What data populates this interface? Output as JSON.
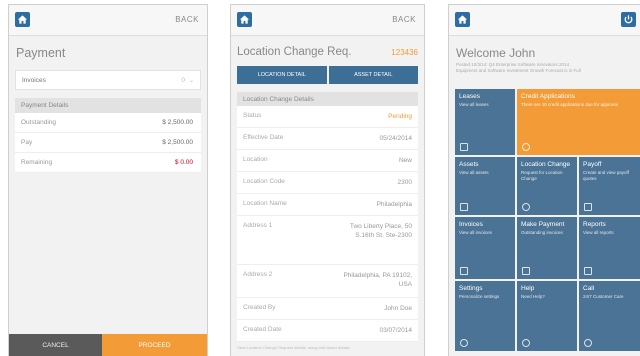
{
  "phone1": {
    "title": "Payment",
    "select": {
      "label": "Invoices",
      "count": "0"
    },
    "section": "Payment Details",
    "rows": [
      {
        "label": "Outstanding",
        "value": "$ 2,500.00"
      },
      {
        "label": "Pay",
        "value": "$ 2,500.00"
      },
      {
        "label": "Remaining",
        "value": "$ 0.00"
      }
    ],
    "back": "BACK",
    "cancel": "CANCEL",
    "proceed": "PROCEED"
  },
  "phone2": {
    "title": "Location Change Req.",
    "number": "123436",
    "back": "BACK",
    "tabs": [
      "LOCATION DETAIL",
      "ASSET DETAIL"
    ],
    "section": "Location Change Details",
    "rows": [
      {
        "label": "Status",
        "value": "Pending"
      },
      {
        "label": "Effective Date",
        "value": "05/24/2014"
      },
      {
        "label": "Location",
        "value": "New"
      },
      {
        "label": "Location Code",
        "value": "2300"
      },
      {
        "label": "Location Name",
        "value": "Philadelphia"
      },
      {
        "label": "Address 1",
        "value": "Two Liberty Place, 50 S.16th St. Ste-2300"
      },
      {
        "label": "Address 2",
        "value": "Philadelphia, PA 19102, USA"
      },
      {
        "label": "Created By",
        "value": "John Doe"
      },
      {
        "label": "Created Date",
        "value": "03/07/2014"
      }
    ],
    "footer": "View Location Change Request details, along with Asset details"
  },
  "phone3": {
    "title": "Welcome John",
    "subtitle_line1": "Posted 10/3/14: Q4 Enterprise Software Innovators 2014",
    "subtitle_line2": "Equipment and Software Investment Growth Forecast is in Full",
    "tiles": [
      {
        "title": "Leases",
        "sub": "View all leases"
      },
      {
        "title": "Credit Applications",
        "sub": "There are 10 credit applications due for approval"
      },
      {
        "title": "Assets",
        "sub": "View all assets"
      },
      {
        "title": "Location Change",
        "sub": "Request for Location Change"
      },
      {
        "title": "Payoff",
        "sub": "Create and view payoff quotes"
      },
      {
        "title": "Invoices",
        "sub": "View all invoices"
      },
      {
        "title": "Make Payment",
        "sub": "Outstanding invoices"
      },
      {
        "title": "Reports",
        "sub": "View all reports"
      },
      {
        "title": "Settings",
        "sub": "Personalize settings"
      },
      {
        "title": "Help",
        "sub": "Need Help?"
      },
      {
        "title": "Call",
        "sub": "24/7 Customer Care"
      }
    ]
  }
}
